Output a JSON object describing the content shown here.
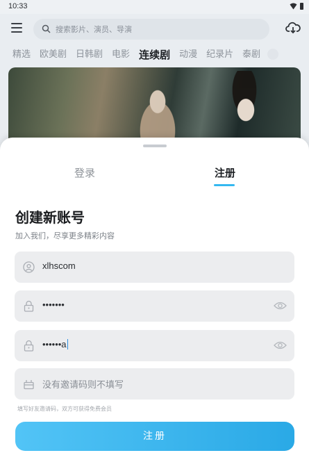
{
  "status_bar": {
    "time": "10:33"
  },
  "top_bar": {
    "search_placeholder": "搜索影片、演员、导演"
  },
  "category_tabs": [
    {
      "label": "精选"
    },
    {
      "label": "欧美剧"
    },
    {
      "label": "日韩剧"
    },
    {
      "label": "电影"
    },
    {
      "label": "连续剧",
      "active": true
    },
    {
      "label": "动漫"
    },
    {
      "label": "纪录片"
    },
    {
      "label": "泰剧"
    }
  ],
  "auth_sheet": {
    "tabs": {
      "login": "登录",
      "register": "注册",
      "active": "register"
    },
    "title": "创建新账号",
    "subtitle": "加入我们，尽享更多精彩内容",
    "fields": {
      "username": {
        "value": "xlhscom"
      },
      "password": {
        "value": "•••••••"
      },
      "confirm_password": {
        "value": "••••••a"
      },
      "invite_code": {
        "placeholder": "没有邀请码则不填写"
      }
    },
    "hint": "填写好友邀请码，双方可获得免费会员",
    "submit_label": "注册"
  },
  "colors": {
    "accent": "#34b8f0",
    "button_start": "#52c4f6",
    "button_end": "#2aa9e6"
  }
}
